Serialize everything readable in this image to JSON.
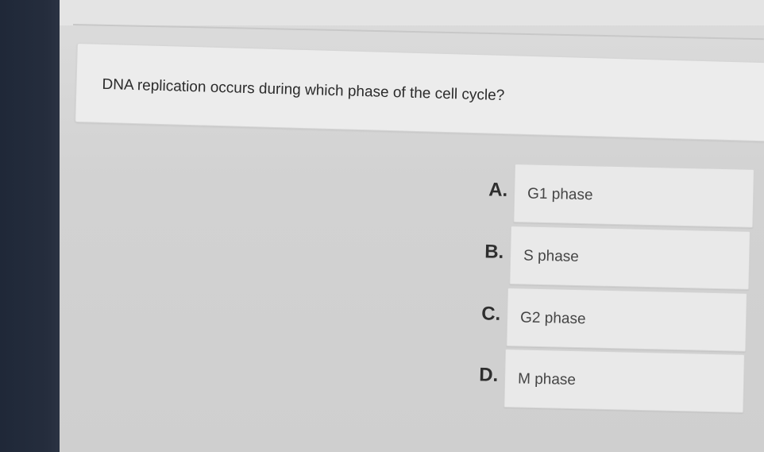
{
  "question": {
    "text": "DNA replication occurs during which phase of the cell cycle?"
  },
  "answers": [
    {
      "letter": "A.",
      "label": "G1 phase"
    },
    {
      "letter": "B.",
      "label": "S phase"
    },
    {
      "letter": "C.",
      "label": "G2 phase"
    },
    {
      "letter": "D.",
      "label": "M phase"
    }
  ],
  "colors": {
    "bezel": "#1f2838",
    "background": "#d2d2d2",
    "card": "#ececec",
    "text": "#2b2b2b"
  }
}
